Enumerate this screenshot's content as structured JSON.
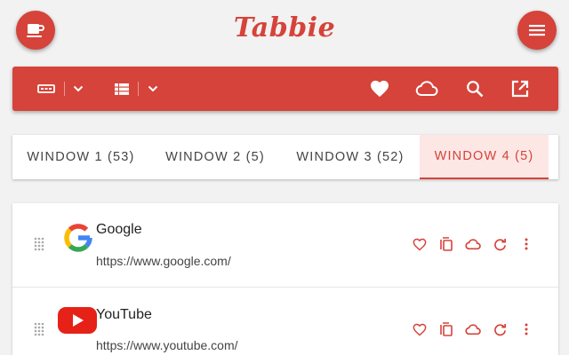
{
  "app": {
    "logo_text": "Tabbie",
    "accent_color": "#d5433a",
    "active_tab_bg": "#fce7e5"
  },
  "header": {
    "left_button_icon": "coffee-cup-icon",
    "right_button_icon": "hamburger-menu-icon"
  },
  "toolbar": {
    "icons": [
      "view-mode-icon",
      "chevron-down-icon",
      "grid-view-icon",
      "chevron-down-icon",
      "heart-icon",
      "cloud-icon",
      "search-icon",
      "open-external-icon"
    ]
  },
  "tabs": [
    {
      "label": "WINDOW 1 (53)",
      "active": false
    },
    {
      "label": "WINDOW 2 (5)",
      "active": false
    },
    {
      "label": "WINDOW 3 (52)",
      "active": false
    },
    {
      "label": "WINDOW 4 (5)",
      "active": true
    }
  ],
  "tab_list": [
    {
      "title": "Google",
      "url": "https://www.google.com/",
      "favicon": "google-logo-icon"
    },
    {
      "title": "YouTube",
      "url": "https://www.youtube.com/",
      "favicon": "youtube-logo-icon"
    }
  ],
  "row_actions": [
    "heart-outline-icon",
    "copy-icon",
    "cloud-outline-icon",
    "refresh-icon",
    "more-vertical-icon"
  ]
}
